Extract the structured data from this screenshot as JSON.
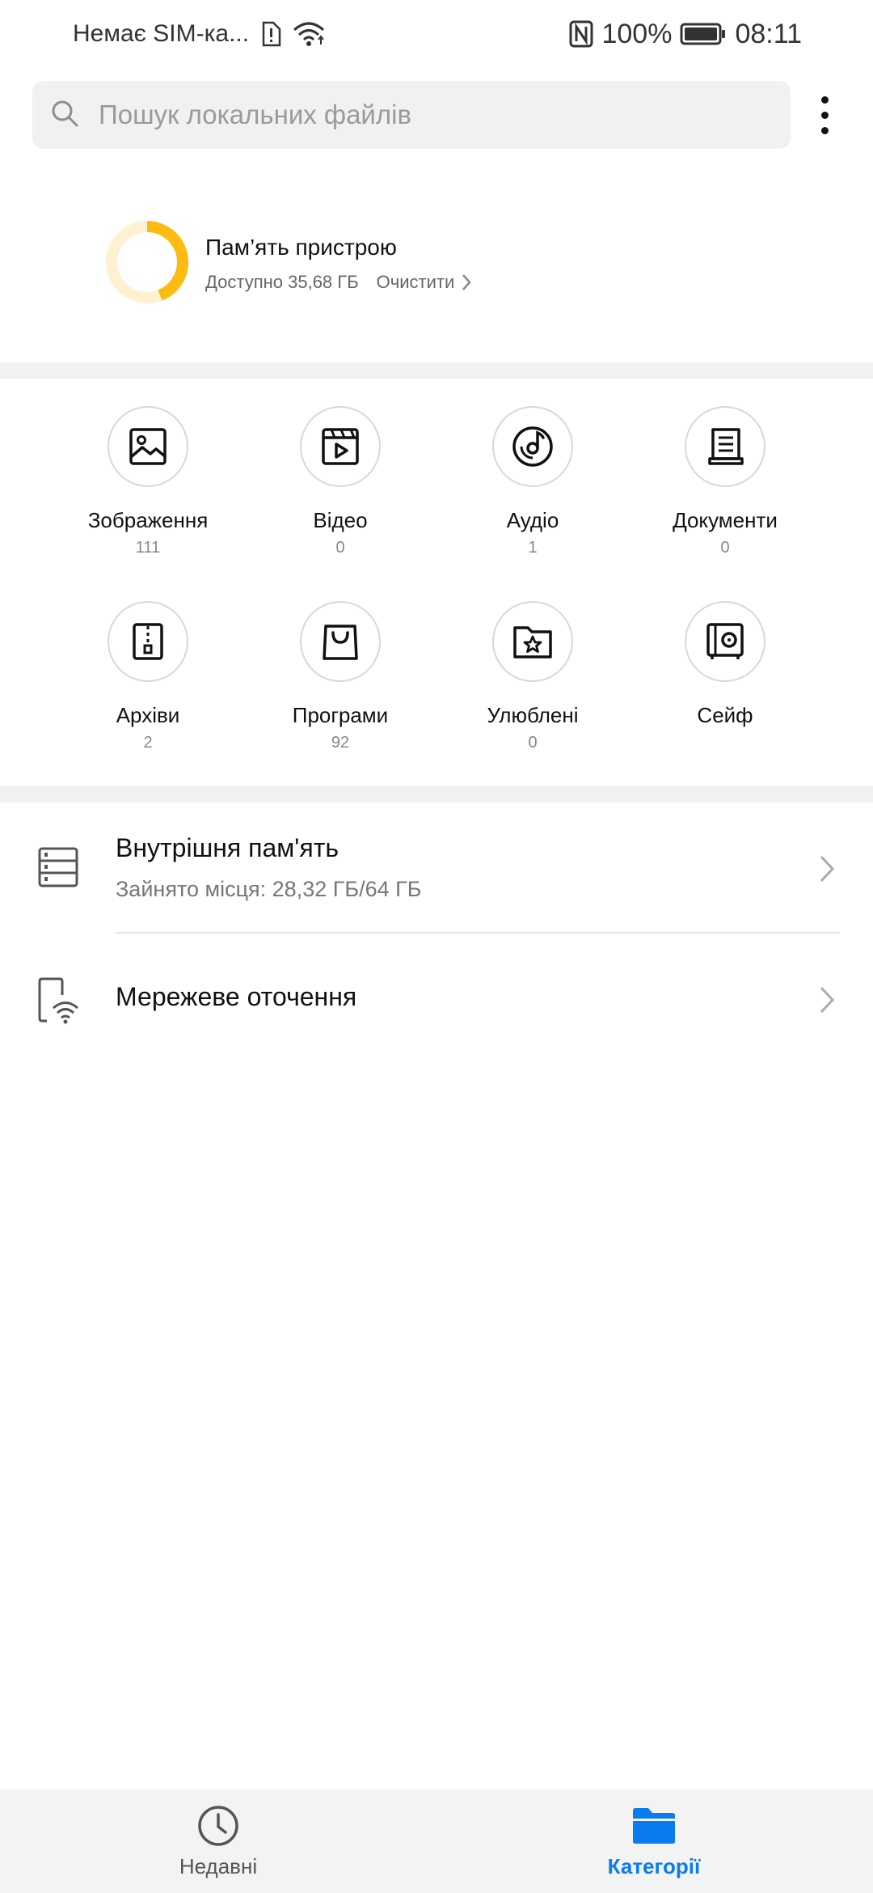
{
  "status_bar": {
    "carrier": "Немає SIM-ка...",
    "battery": "100%",
    "time": "08:11"
  },
  "search": {
    "placeholder": "Пошук локальних файлів"
  },
  "storage_summary": {
    "title": "Пам’ять пристрою",
    "available": "Доступно 35,68 ГБ",
    "clean_label": "Очистити",
    "used_fraction": 0.44,
    "colors": {
      "used": "#fbbb10",
      "free": "#fdf1cf"
    }
  },
  "categories": [
    {
      "label": "Зображення",
      "count": "111",
      "icon": "image-icon"
    },
    {
      "label": "Відео",
      "count": "0",
      "icon": "video-icon"
    },
    {
      "label": "Аудіо",
      "count": "1",
      "icon": "audio-icon"
    },
    {
      "label": "Документи",
      "count": "0",
      "icon": "document-icon"
    },
    {
      "label": "Архіви",
      "count": "2",
      "icon": "archive-icon"
    },
    {
      "label": "Програми",
      "count": "92",
      "icon": "shopping-bag-icon"
    },
    {
      "label": "Улюблені",
      "count": "0",
      "icon": "favorites-folder-icon"
    },
    {
      "label": "Сейф",
      "count": "",
      "icon": "safe-icon"
    }
  ],
  "storage_list": {
    "internal": {
      "title": "Внутрішня пам'ять",
      "subtitle": "Зайнято місця: 28,32 ГБ/64 ГБ"
    },
    "network": {
      "title": "Мережеве оточення"
    }
  },
  "bottom_nav": {
    "recent_label": "Недавні",
    "categories_label": "Категорії",
    "active_color": "#0a7cf0",
    "inactive_color": "#555555"
  }
}
